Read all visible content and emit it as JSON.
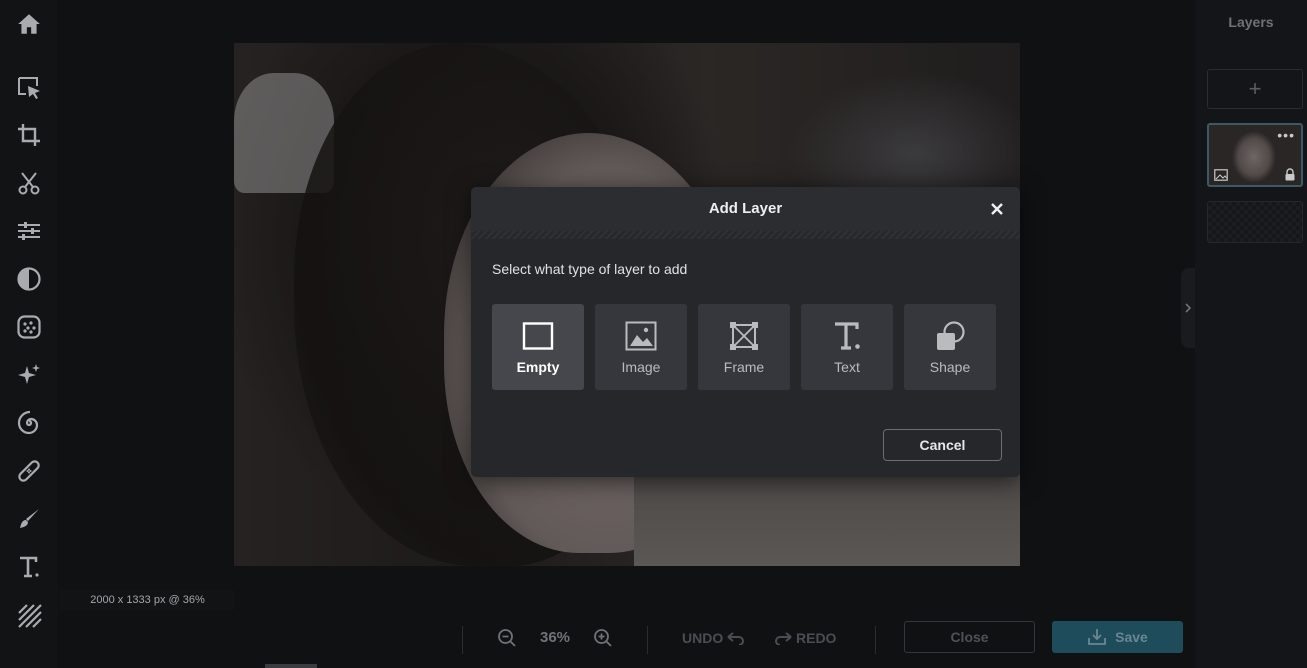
{
  "toolbar": {
    "tools": [
      {
        "name": "home-icon"
      },
      {
        "name": "select-tool-icon"
      },
      {
        "name": "crop-tool-icon"
      },
      {
        "name": "cutout-tool-icon"
      },
      {
        "name": "adjust-tool-icon"
      },
      {
        "name": "filter-tool-icon"
      },
      {
        "name": "effects-tool-icon"
      },
      {
        "name": "retouch-tool-icon"
      },
      {
        "name": "liquify-tool-icon"
      },
      {
        "name": "heal-tool-icon"
      },
      {
        "name": "draw-tool-icon"
      },
      {
        "name": "text-tool-icon"
      },
      {
        "name": "pattern-tool-icon"
      }
    ]
  },
  "canvas": {
    "dimensions_label": "2000 x 1333 px @ 36%"
  },
  "bottombar": {
    "zoom_value": "36%",
    "undo_label": "UNDO",
    "redo_label": "REDO",
    "close_label": "Close",
    "save_label": "Save"
  },
  "layers_panel": {
    "title": "Layers",
    "add_label": "+",
    "more_label": "•••"
  },
  "modal": {
    "title": "Add Layer",
    "subtitle": "Select what type of layer to add",
    "options": [
      {
        "label": "Empty",
        "icon": "empty-layer-icon",
        "selected": true
      },
      {
        "label": "Image",
        "icon": "image-layer-icon",
        "selected": false
      },
      {
        "label": "Frame",
        "icon": "frame-layer-icon",
        "selected": false
      },
      {
        "label": "Text",
        "icon": "text-layer-icon",
        "selected": false
      },
      {
        "label": "Shape",
        "icon": "shape-layer-icon",
        "selected": false
      }
    ],
    "cancel_label": "Cancel"
  },
  "colors": {
    "accent": "#1e4c5a",
    "modal_bg": "#25272b",
    "icon": "#a9abaf"
  }
}
